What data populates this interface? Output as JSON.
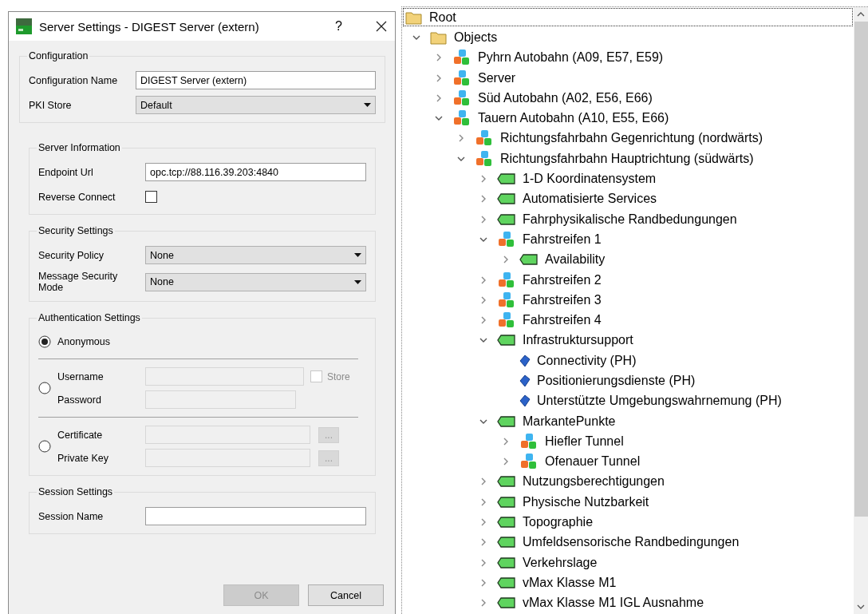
{
  "dialog": {
    "title": "Server Settings - DIGEST Server (extern)",
    "help": "?",
    "configuration": {
      "title": "Configuration",
      "fields": [
        {
          "label": "Configuration Name",
          "kind": "text",
          "value": "DIGEST Server (extern)"
        },
        {
          "label": "PKI Store",
          "kind": "dropdown",
          "value": "Default"
        }
      ]
    },
    "groups": [
      {
        "title": "Server Information",
        "fields": [
          {
            "label": "Endpoint Url",
            "kind": "text",
            "value": "opc.tcp://88.116.39.203:4840"
          },
          {
            "label": "Reverse Connect",
            "kind": "checkbox",
            "checked": false
          }
        ]
      },
      {
        "title": "Security Settings",
        "fields": [
          {
            "label": "Security Policy",
            "kind": "dropdown",
            "value": "None"
          },
          {
            "label": "Message Security Mode",
            "kind": "dropdown",
            "value": "None"
          }
        ]
      }
    ],
    "authentication": {
      "title": "Authentication Settings",
      "options": [
        {
          "selected": true,
          "label": "Anonymous"
        },
        {
          "selected": false,
          "fields": [
            {
              "label": "Username",
              "kind": "text",
              "disabled": true,
              "store": {
                "label": "Store",
                "checked": false,
                "disabled": true
              }
            },
            {
              "label": "Password",
              "kind": "text",
              "disabled": true
            }
          ]
        },
        {
          "selected": false,
          "fields": [
            {
              "label": "Certificate",
              "kind": "text",
              "disabled": true,
              "browse": "..."
            },
            {
              "label": "Private Key",
              "kind": "text",
              "disabled": true,
              "browse": "..."
            }
          ]
        }
      ]
    },
    "session": {
      "title": "Session Settings",
      "fields": [
        {
          "label": "Session Name",
          "kind": "text"
        }
      ]
    },
    "buttons": [
      {
        "label": "OK",
        "disabled": true
      },
      {
        "label": "Cancel",
        "disabled": false
      }
    ]
  },
  "tree": {
    "label": "Root",
    "kind": "folder",
    "selected": true,
    "children": [
      {
        "label": "Objects",
        "kind": "folder",
        "selected": false,
        "expanded": true,
        "children": [
          {
            "label": "Pyhrn Autobahn (A09, E57, E59)",
            "kind": "object",
            "selected": false,
            "expanded": false
          },
          {
            "label": "Server",
            "kind": "object",
            "selected": false,
            "expanded": false
          },
          {
            "label": "Süd Autobahn (A02, E56, E66)",
            "kind": "object",
            "selected": false,
            "expanded": false
          },
          {
            "label": "Tauern Autobahn (A10, E55, E66)",
            "kind": "object",
            "selected": false,
            "expanded": true,
            "children": [
              {
                "label": "Richtungsfahrbahn Gegenrichtung (nordwärts)",
                "kind": "object",
                "selected": false,
                "expanded": false
              },
              {
                "label": "Richtungsfahrbahn Hauptrichtung (südwärts)",
                "kind": "object",
                "selected": false,
                "expanded": true,
                "children": [
                  {
                    "label": "1-D Koordinatensystem",
                    "kind": "tag",
                    "selected": false,
                    "expanded": false
                  },
                  {
                    "label": "Automatisierte Services",
                    "kind": "tag",
                    "selected": false,
                    "expanded": false
                  },
                  {
                    "label": "Fahrphysikalische Randbedungungen",
                    "kind": "tag",
                    "selected": false,
                    "expanded": false
                  },
                  {
                    "label": "Fahrstreifen 1",
                    "kind": "object",
                    "selected": false,
                    "expanded": true,
                    "children": [
                      {
                        "label": "Availability",
                        "kind": "tag",
                        "selected": false,
                        "expanded": false
                      }
                    ]
                  },
                  {
                    "label": "Fahrstreifen 2",
                    "kind": "object",
                    "selected": false,
                    "expanded": false
                  },
                  {
                    "label": "Fahrstreifen 3",
                    "kind": "object",
                    "selected": false,
                    "expanded": false
                  },
                  {
                    "label": "Fahrstreifen 4",
                    "kind": "object",
                    "selected": false,
                    "expanded": false
                  },
                  {
                    "label": "Infrastruktursupport",
                    "kind": "tag",
                    "selected": false,
                    "expanded": true,
                    "children": [
                      {
                        "label": "Connectivity  (PH)",
                        "kind": "variable",
                        "selected": false
                      },
                      {
                        "label": "Positionierungsdienste (PH)",
                        "kind": "variable",
                        "selected": false
                      },
                      {
                        "label": "Unterstützte Umgebungswahrnemung (PH)",
                        "kind": "variable",
                        "selected": false
                      }
                    ]
                  },
                  {
                    "label": "MarkantePunkte",
                    "kind": "tag",
                    "selected": false,
                    "expanded": true,
                    "children": [
                      {
                        "label": "Hiefler Tunnel",
                        "kind": "object",
                        "selected": false,
                        "expanded": false
                      },
                      {
                        "label": "Ofenauer Tunnel",
                        "kind": "object",
                        "selected": false,
                        "expanded": false
                      }
                    ]
                  },
                  {
                    "label": "Nutzungsberechtigungen",
                    "kind": "tag",
                    "selected": false,
                    "expanded": false
                  },
                  {
                    "label": "Physische Nutzbarkeit",
                    "kind": "tag",
                    "selected": false,
                    "expanded": false
                  },
                  {
                    "label": "Topographie",
                    "kind": "tag",
                    "selected": false,
                    "expanded": false
                  },
                  {
                    "label": "Umfeldsensorische Randbedingungen",
                    "kind": "tag",
                    "selected": false,
                    "expanded": false
                  },
                  {
                    "label": "Verkehrslage",
                    "kind": "tag",
                    "selected": false,
                    "expanded": false
                  },
                  {
                    "label": "vMax Klasse M1",
                    "kind": "tag",
                    "selected": false,
                    "expanded": false
                  },
                  {
                    "label": "vMax Klasse M1 IGL Ausnahme",
                    "kind": "tag",
                    "selected": false,
                    "expanded": false
                  }
                ]
              }
            ]
          }
        ]
      }
    ]
  }
}
